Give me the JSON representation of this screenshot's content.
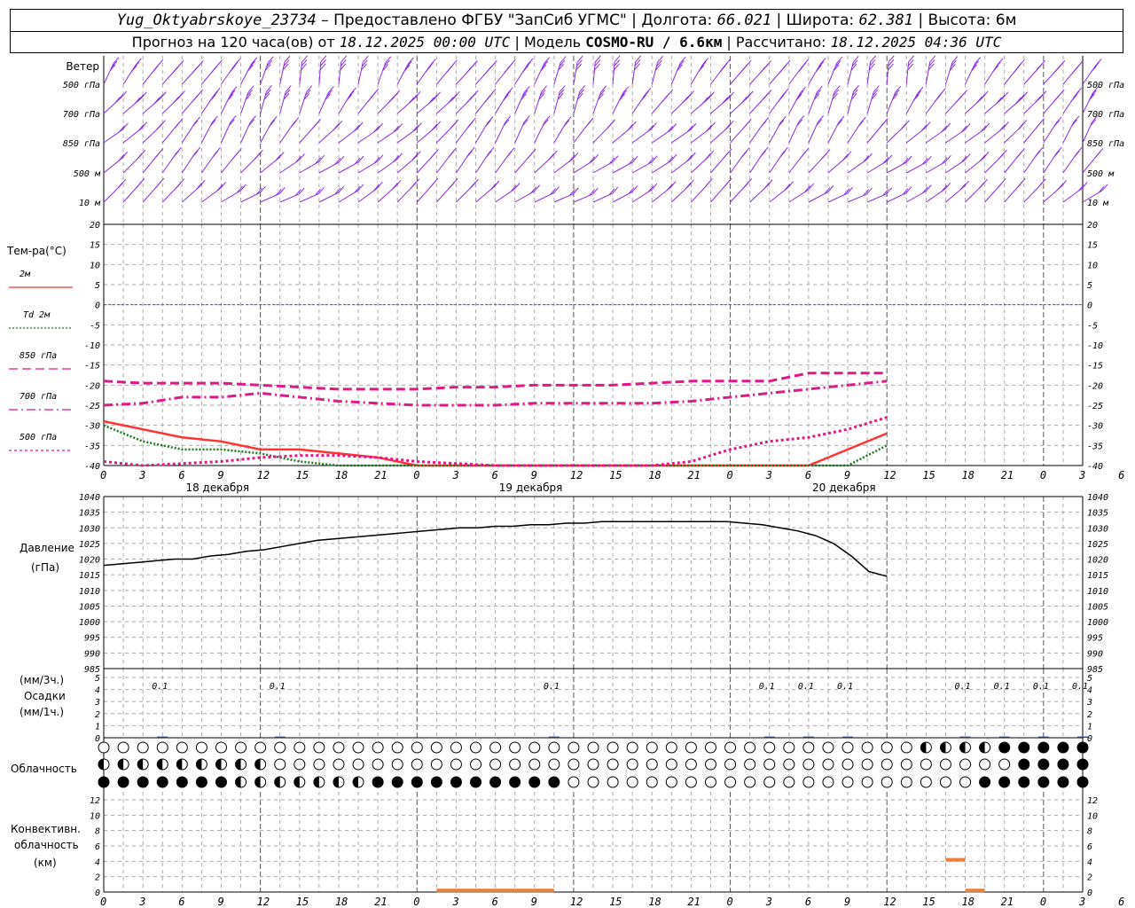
{
  "header": {
    "station": "Yug_Oktyabrskoye_23734",
    "provided": "– Предоставлено ФГБУ \"ЗапСиб УГМС\"",
    "lon_label": "Долгота:",
    "lon": "66.021",
    "lat_label": "Широта:",
    "lat": "62.381",
    "alt_label": "Высота:",
    "alt": "6м",
    "forecast_label": "Прогноз на 120 часа(ов) от",
    "forecast_from": "18.12.2025 00:00 UTC",
    "model_label": "Модель",
    "model": "COSMO-RU / 6.6км",
    "computed_label": "Рассчитано:",
    "computed": "18.12.2025 04:36 UTC"
  },
  "panels": {
    "wind": {
      "title": "Ветер",
      "levels": [
        "500 гПа",
        "700 гПа",
        "850 гПа",
        "500 м",
        "10  м"
      ],
      "color": "#8a2be2"
    },
    "temp": {
      "title": "Тем-ра(°C)",
      "legend": [
        {
          "label": "2м",
          "color": "#ff3333",
          "style": "solid"
        },
        {
          "label": "Td  2м",
          "color": "#1a7a1a",
          "style": "dotted"
        },
        {
          "label": "850 гПа",
          "color": "#e0198a",
          "style": "dash"
        },
        {
          "label": "700 гПа",
          "color": "#e0198a",
          "style": "dashdot"
        },
        {
          "label": "500 гПа",
          "color": "#e0198a",
          "style": "dot"
        }
      ],
      "yticks": [
        "20",
        "15",
        "10",
        "5",
        "0",
        "-5",
        "-10",
        "-15",
        "-20",
        "-25",
        "-30",
        "-35",
        "-40"
      ]
    },
    "pressure": {
      "title1": "Давление",
      "title2": "(гПа)",
      "yticks": [
        "1040",
        "1035",
        "1030",
        "1025",
        "1020",
        "1015",
        "1010",
        "1005",
        "1000",
        "995",
        "990",
        "985"
      ]
    },
    "precip": {
      "unit1": "(мм/3ч.)",
      "title": "Осадки",
      "unit2": "(мм/1ч.)",
      "yticks": [
        "5",
        "4",
        "3",
        "2",
        "1",
        "0"
      ],
      "amounts": [
        "0.1",
        "0.1",
        "0.1",
        "0.1",
        "0.1",
        "0.1",
        "0.1",
        "0.1",
        "0.1",
        "0.1"
      ]
    },
    "clouds": {
      "title": "Облачность"
    },
    "conv": {
      "title1": "Конвективн.",
      "title2": "облачность",
      "title3": "(км)",
      "yticks": [
        "12",
        "10",
        "8",
        "6",
        "4",
        "2",
        "0"
      ]
    }
  },
  "xaxis": {
    "hour_labels": [
      "0",
      "3",
      "6",
      "9",
      "12",
      "15",
      "18",
      "21",
      "0",
      "3",
      "6",
      "9",
      "12",
      "15",
      "18",
      "21",
      "0",
      "3",
      "6",
      "9",
      "12",
      "15",
      "18",
      "21",
      "0",
      "3",
      "6"
    ],
    "dates": [
      "18 декабря",
      "19 декабря",
      "20 декабря"
    ]
  },
  "chart_data": {
    "type": "line",
    "x_hours": [
      0,
      6,
      12,
      18,
      24,
      30,
      36,
      42,
      48,
      54,
      60,
      66,
      72,
      78,
      84,
      90,
      96,
      102,
      108,
      114,
      120
    ],
    "temperature": {
      "ylim": [
        -40,
        20
      ],
      "series": [
        {
          "name": "2м",
          "values": [
            -29,
            -31,
            -33,
            -34,
            -36,
            -36,
            -37,
            -38,
            -40,
            -40,
            -40,
            -40,
            -40,
            -40,
            -40,
            -40,
            -40,
            -40,
            -40,
            -36,
            -32
          ]
        },
        {
          "name": "Td  2м",
          "values": [
            -30,
            -34,
            -36,
            -36,
            -37,
            -39,
            -40,
            -40,
            -40,
            -40,
            -40,
            -40,
            -40,
            -40,
            -40,
            -40,
            -40,
            -40,
            -40,
            -40,
            -35
          ]
        },
        {
          "name": "850 гПа",
          "values": [
            -19,
            -19.5,
            -19.5,
            -19.5,
            -20,
            -20.5,
            -21,
            -21,
            -21,
            -20.5,
            -20.5,
            -20,
            -20,
            -20,
            -19.5,
            -19,
            -19,
            -19,
            -17,
            -17,
            -17
          ]
        },
        {
          "name": "700 гПа",
          "values": [
            -25,
            -24.5,
            -23,
            -23,
            -22,
            -23,
            -24,
            -24.5,
            -25,
            -25,
            -25,
            -24.5,
            -24.5,
            -24.5,
            -24.5,
            -24,
            -23,
            -22,
            -21,
            -20,
            -19
          ]
        },
        {
          "name": "500 гПа",
          "values": [
            -39,
            -40,
            -39.5,
            -39,
            -38,
            -37.5,
            -37.5,
            -38,
            -39,
            -39.5,
            -40,
            -40,
            -40,
            -40,
            -40,
            -39,
            -36,
            -34,
            -33,
            -31,
            -28
          ]
        }
      ]
    },
    "pressure": {
      "ylim": [
        985,
        1040
      ],
      "values": [
        1018,
        1018.5,
        1019,
        1019.5,
        1020,
        1020,
        1021,
        1021.5,
        1022.5,
        1023,
        1024,
        1025,
        1026,
        1026.5,
        1027,
        1027.5,
        1028,
        1028.5,
        1029,
        1029.5,
        1030,
        1030,
        1030.5,
        1030.5,
        1031,
        1031,
        1031.5,
        1031.5,
        1032,
        1032,
        1032,
        1032,
        1032,
        1032,
        1032,
        1032,
        1031.5,
        1031,
        1030,
        1029,
        1027.5,
        1025,
        1021,
        1016,
        1014.5
      ]
    },
    "precipitation": {
      "ylim": [
        0,
        5
      ],
      "x_hours": [
        9,
        27,
        69,
        102,
        108,
        114,
        132,
        138,
        144,
        150
      ],
      "values": [
        0.1,
        0.1,
        0.1,
        0.1,
        0.1,
        0.1,
        0.1,
        0.1,
        0.1,
        0.1
      ]
    },
    "convective_cloud": {
      "ylim": [
        0,
        12
      ],
      "segments": [
        {
          "from_hour": 129,
          "to_hour": 132,
          "height_km": 4.2
        },
        {
          "from_hour": 51,
          "to_hour": 69,
          "height_km": 0.2
        },
        {
          "from_hour": 132,
          "to_hour": 135,
          "height_km": 0.2
        }
      ]
    }
  }
}
